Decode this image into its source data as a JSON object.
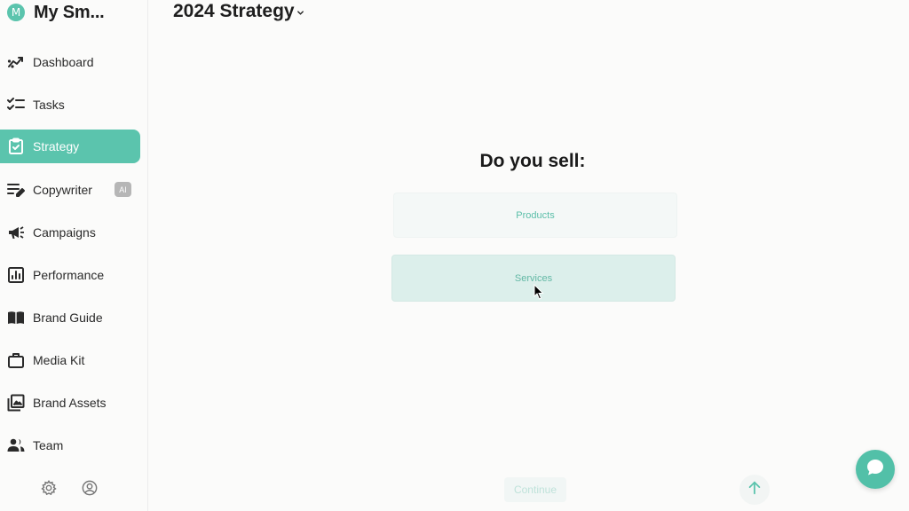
{
  "app": {
    "name": "My Sm...",
    "avatar_letter": "M",
    "accent_color": "#5bc4ad"
  },
  "sidebar": {
    "items": [
      {
        "label": "Dashboard",
        "icon": "trend-chart-icon",
        "active": false
      },
      {
        "label": "Tasks",
        "icon": "checklist-icon",
        "active": false
      },
      {
        "label": "Strategy",
        "icon": "clipboard-check-icon",
        "active": true
      },
      {
        "label": "Copywriter",
        "icon": "edit-lines-icon",
        "active": false,
        "badge": "AI"
      },
      {
        "label": "Campaigns",
        "icon": "megaphone-icon",
        "active": false
      },
      {
        "label": "Performance",
        "icon": "bar-chart-icon",
        "active": false
      },
      {
        "label": "Brand Guide",
        "icon": "open-book-icon",
        "active": false
      },
      {
        "label": "Media Kit",
        "icon": "briefcase-icon",
        "active": false
      },
      {
        "label": "Brand Assets",
        "icon": "image-gallery-icon",
        "active": false
      },
      {
        "label": "Team",
        "icon": "people-icon",
        "active": false
      }
    ],
    "footer_icons": [
      "gear-icon",
      "user-circle-icon"
    ]
  },
  "header": {
    "title": "2024 Strategy"
  },
  "main": {
    "question": "Do you sell:",
    "options": [
      {
        "label": "Products",
        "selected": false
      },
      {
        "label": "Services",
        "selected": true
      }
    ],
    "continue_label": "Continue"
  },
  "widgets": {
    "scroll_up_icon": "arrow-up-icon",
    "chat_icon": "chat-bubble-icon"
  }
}
